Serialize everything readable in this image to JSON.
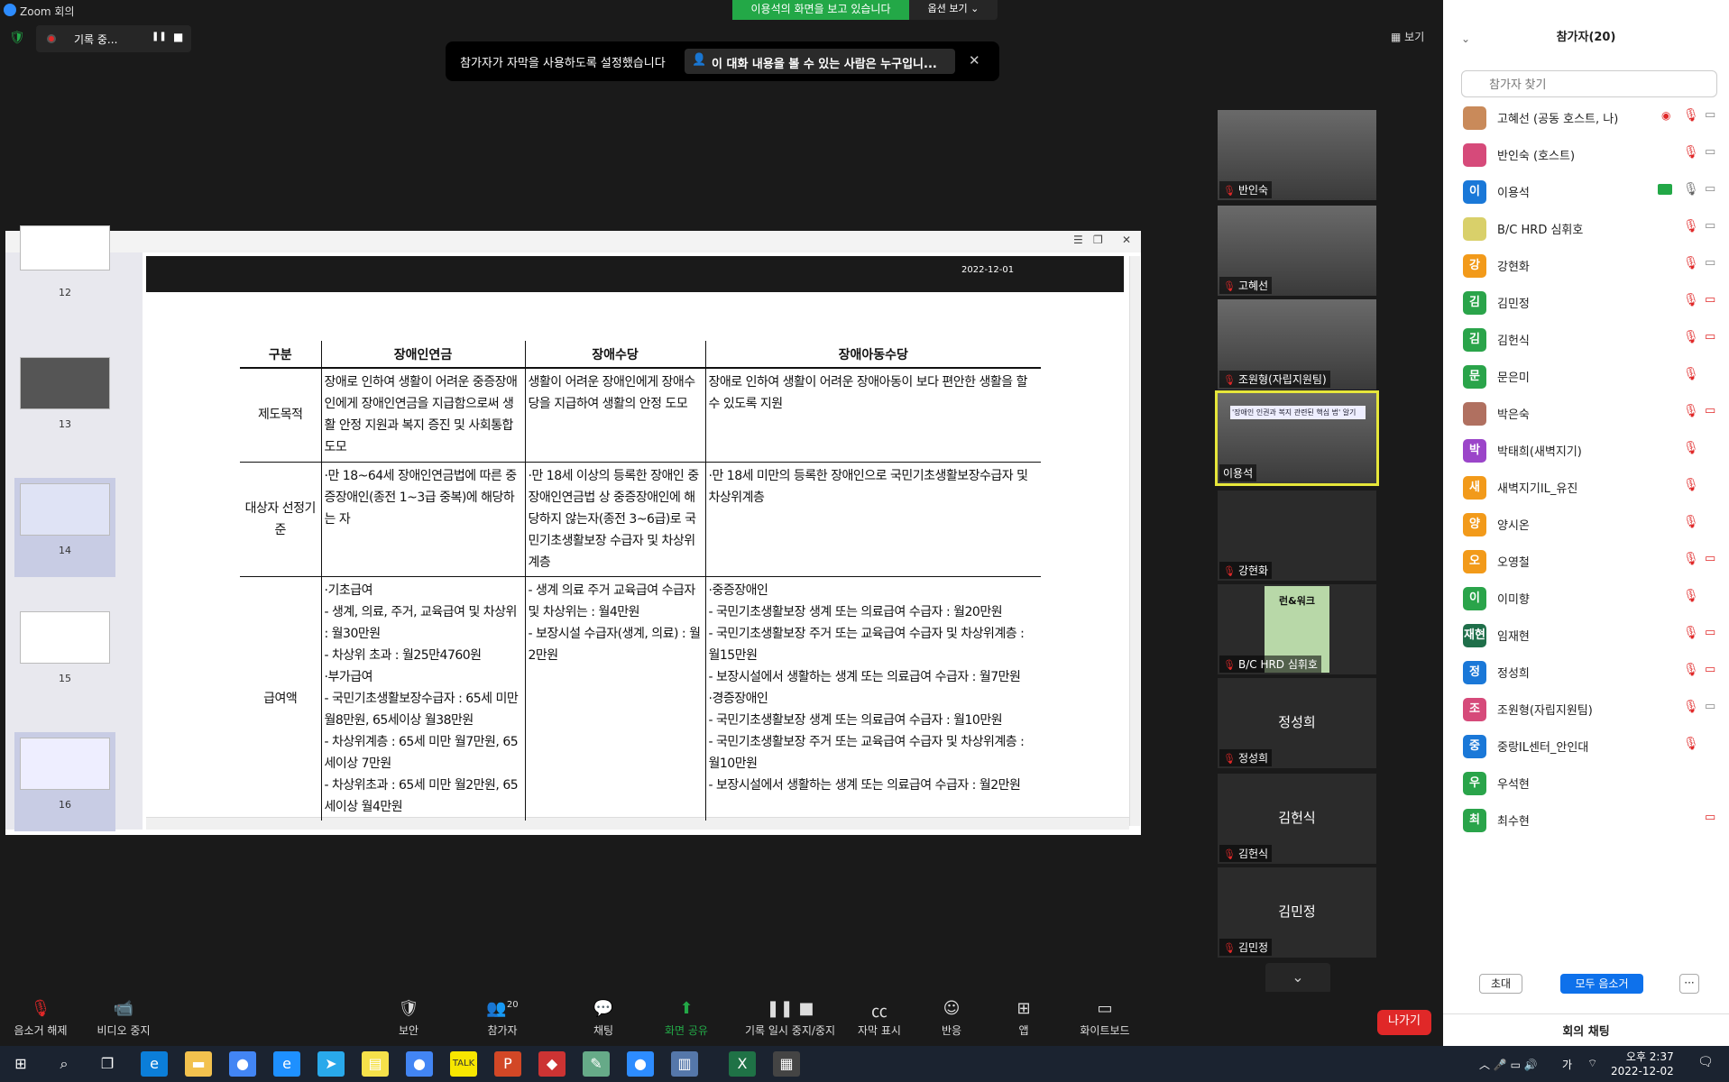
{
  "window": {
    "title": "Zoom 회의",
    "minimize": "—",
    "maximize": "❐",
    "close": "✕"
  },
  "top": {
    "share_banner": "이용석의 화면을 보고 있습니다",
    "view_options": "옵션 보기 ⌄",
    "recording_label": "기록 중...",
    "caption_notice": "참가자가 자막을 사용하도록 설정했습니다",
    "caption_who": "이 대화 내용을 볼 수 있는 사람은 누구입니...",
    "view_button": "보기"
  },
  "shared_screen": {
    "slide_date": "2022-12-01",
    "thumbnails": [
      {
        "num": "12"
      },
      {
        "num": "13"
      },
      {
        "num": "14"
      },
      {
        "num": "15"
      },
      {
        "num": "16"
      }
    ],
    "table": {
      "headers": [
        "구분",
        "장애인연금",
        "장애수당",
        "장애아동수당"
      ],
      "rows": [
        {
          "label": "제도목적",
          "c1": "장애로 인하여 생활이 어려운 중증장애인에게 장애인연금을 지급함으로써 생활 안정 지원과 복지 증진 및 사회통합 도모",
          "c2": "생활이 어려운 장애인에게 장애수당을 지급하여 생활의 안정 도모",
          "c3": "장애로 인하여 생활이 어려운 장애아동이 보다 편안한 생활을 할 수 있도록 지원"
        },
        {
          "label": "대상자 선정기준",
          "c1": "·만 18~64세 장애인연금법에 따른 중증장애인(종전 1~3급 중복)에 해당하는 자",
          "c2": "·만 18세 이상의 등록한 장애인 중 장애인연금법 상 중증장애인에 해당하지 않는자(종전 3~6급)로 국민기초생활보장 수급자 및 차상위계층",
          "c3": "·만 18세 미만의 등록한 장애인으로 국민기초생활보장수급자 및 차상위계층"
        },
        {
          "label": "급여액",
          "c1": "·기초급여\n- 생계, 의료, 주거, 교육급여 및 차상위 : 월30만원\n- 차상위 초과 : 월25만4760원\n·부가급여\n- 국민기초생활보장수급자 : 65세 미만 월8만원, 65세이상 월38만원\n- 차상위계층 : 65세 미만 월7만원, 65세이상 7만원\n- 차상위초과 : 65세 미만 월2만원, 65세이상 월4만원",
          "c2": "- 생계 의료 주거 교육급여 수급자 및 차상위는 : 월4만원\n- 보장시설 수급자(생계, 의료) : 월2만원",
          "c3": "·중증장애인\n- 국민기초생활보장 생계 또는 의료급여 수급자 : 월20만원\n- 국민기초생활보장 주거 또는 교육급여 수급자 및 차상위계층 : 월15만원\n- 보장시설에서 생활하는 생계 또는 의료급여 수급자 : 월7만원\n·경증장애인\n- 국민기초생활보장 생계 또는 의료급여 수급자 : 월10만원\n- 국민기초생활보장 주거 또는 교육급여 수급자 및 차상위계층 : 월10만원\n- 보장시설에서 생활하는 생계 또는 의료급여 수급자 : 월2만원"
        }
      ]
    }
  },
  "videos": [
    {
      "name": "반인숙",
      "type": "video"
    },
    {
      "name": "고혜선",
      "type": "video"
    },
    {
      "name": "조원형(자립지원팀)",
      "type": "video"
    },
    {
      "name": "이용석",
      "type": "video",
      "active": true
    },
    {
      "name": "강현화",
      "type": "blank"
    },
    {
      "name": "B/C HRD 심휘호",
      "type": "image"
    },
    {
      "name": "정성희",
      "type": "text",
      "big": "정성희"
    },
    {
      "name": "김헌식",
      "type": "text",
      "big": "김헌식"
    },
    {
      "name": "김민정",
      "type": "text",
      "big": "김민정"
    }
  ],
  "video_strip_extra": {
    "slide_title": "'장애인 인권과 복지 관련된 핵심 법' 알기",
    "video_badge": "런&워크"
  },
  "panel": {
    "title": "참가자(20)",
    "search_placeholder": "참가자 찾기",
    "participants": [
      {
        "name": "고혜선 (공동 호스트, 나)",
        "initial": "",
        "color": "#c98a5a",
        "mic": "muted",
        "cam": "on",
        "rec": true
      },
      {
        "name": "반인숙 (호스트)",
        "initial": "",
        "color": "#d64a7a",
        "mic": "muted",
        "cam": "on"
      },
      {
        "name": "이용석",
        "initial": "이",
        "color": "#1a78d8",
        "mic": "on",
        "cam": "on",
        "share": true
      },
      {
        "name": "B/C HRD 심휘호",
        "initial": "",
        "color": "#d9d06a",
        "mic": "muted",
        "cam": "on"
      },
      {
        "name": "강현화",
        "initial": "강",
        "color": "#f29a1a",
        "mic": "muted",
        "cam": "on"
      },
      {
        "name": "김민정",
        "initial": "김",
        "color": "#2aa44a",
        "mic": "muted",
        "cam": "off"
      },
      {
        "name": "김헌식",
        "initial": "김",
        "color": "#2aa44a",
        "mic": "muted",
        "cam": "off"
      },
      {
        "name": "문은미",
        "initial": "문",
        "color": "#2aa44a",
        "mic": "muted",
        "cam": "none"
      },
      {
        "name": "박은숙",
        "initial": "",
        "color": "#b07060",
        "mic": "muted",
        "cam": "off"
      },
      {
        "name": "박태희(새벽지기)",
        "initial": "박",
        "color": "#9b45c9",
        "mic": "muted",
        "cam": "none"
      },
      {
        "name": "새벽지기IL_유진",
        "initial": "새",
        "color": "#f29a1a",
        "mic": "muted",
        "cam": "none"
      },
      {
        "name": "양시온",
        "initial": "양",
        "color": "#f29a1a",
        "mic": "muted",
        "cam": "none"
      },
      {
        "name": "오영철",
        "initial": "오",
        "color": "#f29a1a",
        "mic": "muted",
        "cam": "off"
      },
      {
        "name": "이미향",
        "initial": "이",
        "color": "#2aa44a",
        "mic": "muted",
        "cam": "none"
      },
      {
        "name": "임재현",
        "initial": "재현",
        "color": "#1f6f4a",
        "mic": "muted",
        "cam": "off"
      },
      {
        "name": "정성희",
        "initial": "정",
        "color": "#1a78d8",
        "mic": "muted",
        "cam": "off"
      },
      {
        "name": "조원형(자립지원팀)",
        "initial": "조",
        "color": "#d64a7a",
        "mic": "muted",
        "cam": "on"
      },
      {
        "name": "중랑IL센터_안인대",
        "initial": "중",
        "color": "#1a78d8",
        "mic": "muted",
        "cam": "none"
      },
      {
        "name": "우석현",
        "initial": "우",
        "color": "#2aa44a",
        "mic": "none",
        "cam": "none"
      },
      {
        "name": "최수현",
        "initial": "최",
        "color": "#2aa44a",
        "mic": "none",
        "cam": "off"
      }
    ],
    "invite": "초대",
    "mute_all": "모두 음소거",
    "more": "···",
    "chat_header": "회의 채팅"
  },
  "toolbar": {
    "unmute": "음소거 해제",
    "video_stop": "비디오 중지",
    "security": "보안",
    "participants": "참가자",
    "participants_count": "20",
    "chat": "채팅",
    "share": "화면 공유",
    "record_pause": "기록 일시 중지/중지",
    "captions": "자막 표시",
    "reactions": "반응",
    "apps": "앱",
    "whiteboard": "화이트보드",
    "leave": "나가기"
  },
  "taskbar": {
    "time": "오후 2:37",
    "date": "2022-12-02",
    "ime": "가"
  }
}
